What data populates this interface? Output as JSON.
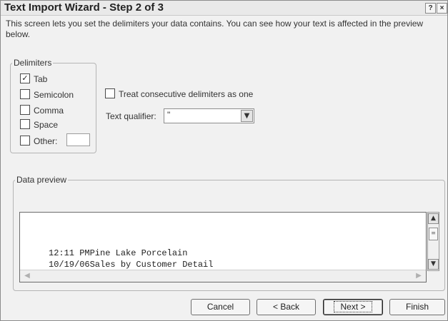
{
  "window": {
    "title": "Text Import Wizard - Step 2 of 3",
    "help_glyph": "?",
    "close_glyph": "×"
  },
  "intro_text": "This screen lets you set the delimiters your data contains. You can see how your text is affected in the preview below.",
  "delimiters": {
    "legend": "Delimiters",
    "options": [
      {
        "label": "Tab",
        "checked": true
      },
      {
        "label": "Semicolon",
        "checked": false
      },
      {
        "label": "Comma",
        "checked": false
      },
      {
        "label": "Space",
        "checked": false
      },
      {
        "label": "Other:",
        "checked": false
      }
    ],
    "other_value": ""
  },
  "consecutive": {
    "label": "Treat consecutive delimiters as one",
    "checked": false
  },
  "text_qualifier": {
    "label": "Text qualifier:",
    "value": "\""
  },
  "preview": {
    "legend": "Data preview",
    "lines": [
      "12:11 PMPine Lake Porcelain",
      "10/19/06Sales by Customer Detail"
    ]
  },
  "buttons": {
    "cancel": "Cancel",
    "back": "< Back",
    "next": "Next >",
    "finish": "Finish"
  },
  "icons": {
    "check": "check-icon",
    "dropdown": "chevron-down-icon",
    "scroll_up": "scroll-up-icon",
    "scroll_down": "scroll-down-icon",
    "scroll_left": "scroll-left-icon",
    "scroll_right": "scroll-right-icon"
  }
}
